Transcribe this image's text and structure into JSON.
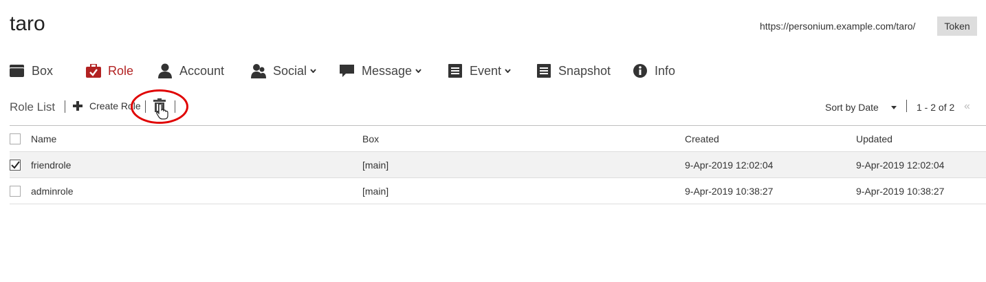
{
  "header": {
    "title": "taro",
    "url": "https://personium.example.com/taro/",
    "token_label": "Token"
  },
  "nav": [
    {
      "label": "Box",
      "icon": "box-icon",
      "active": false,
      "dropdown": false
    },
    {
      "label": "Role",
      "icon": "briefcase-check-icon",
      "active": true,
      "dropdown": false
    },
    {
      "label": "Account",
      "icon": "user-icon",
      "active": false,
      "dropdown": false
    },
    {
      "label": "Social",
      "icon": "users-icon",
      "active": false,
      "dropdown": true
    },
    {
      "label": "Message",
      "icon": "speech-bubble-icon",
      "active": false,
      "dropdown": true
    },
    {
      "label": "Event",
      "icon": "document-icon",
      "active": false,
      "dropdown": true
    },
    {
      "label": "Snapshot",
      "icon": "document-icon",
      "active": false,
      "dropdown": false
    },
    {
      "label": "Info",
      "icon": "info-icon",
      "active": false,
      "dropdown": false
    }
  ],
  "toolbar": {
    "section_label": "Role List",
    "create_label": "Create Role",
    "sort_label": "Sort by Date",
    "pager_text": "1 - 2 of 2",
    "first_page_symbol": "«"
  },
  "table": {
    "columns": [
      "Name",
      "Box",
      "Created",
      "Updated"
    ],
    "rows": [
      {
        "name": "friendrole",
        "box": "[main]",
        "created": "9-Apr-2019 12:02:04",
        "updated": "9-Apr-2019 12:02:04",
        "checked": true
      },
      {
        "name": "adminrole",
        "box": "[main]",
        "created": "9-Apr-2019 10:38:27",
        "updated": "9-Apr-2019 10:38:27",
        "checked": false
      }
    ]
  },
  "colors": {
    "accent": "#b22222",
    "highlight_circle": "#e00000"
  }
}
